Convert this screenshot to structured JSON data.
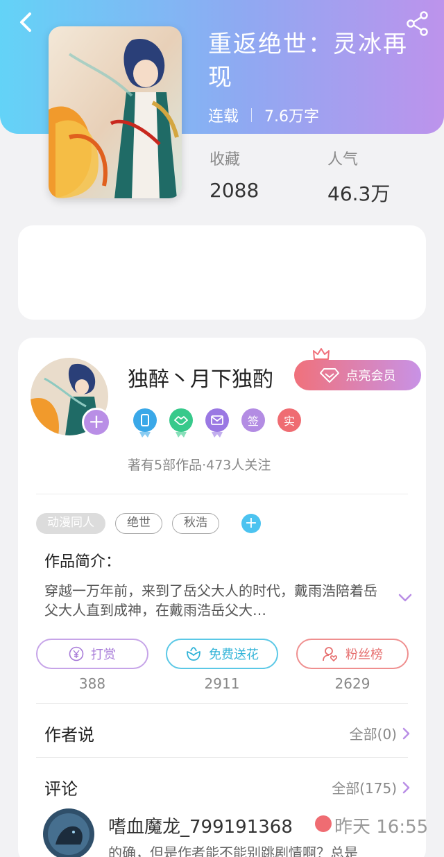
{
  "header": {
    "back_icon": "back-chevron-icon",
    "share_icon": "share-icon",
    "gradient": [
      "#63d3f7",
      "#bd93ec"
    ]
  },
  "book": {
    "title": "重返绝世：灵冰再现",
    "status": "连载",
    "word_count": "7.6万字",
    "stats": [
      {
        "label": "收藏",
        "value": "2088"
      },
      {
        "label": "人气",
        "value": "46.3万"
      }
    ]
  },
  "author": {
    "name": "独醉丶月下独酌",
    "vip_button": "点亮会员",
    "badges": [
      {
        "icon": "phone-badge-icon",
        "text": ""
      },
      {
        "icon": "handshake-badge-icon",
        "text": ""
      },
      {
        "icon": "envelope-badge-icon",
        "text": ""
      },
      {
        "icon": "sign-badge",
        "text": "签"
      },
      {
        "icon": "real-badge",
        "text": "实"
      }
    ],
    "works_info": "著有5部作品·473人关注"
  },
  "tags": {
    "items": [
      "动漫同人",
      "绝世",
      "秋浩"
    ],
    "add_icon": "plus-icon"
  },
  "intro": {
    "title": "作品简介：",
    "text": "穿越一万年前，来到了岳父大人的时代，戴雨浩陪着岳父大人直到成神，在戴雨浩岳父大…"
  },
  "actions": [
    {
      "label": "打赏",
      "icon": "yen-icon",
      "count": "388",
      "color": "#a77ad8"
    },
    {
      "label": "免费送花",
      "icon": "flower-icon",
      "count": "2911",
      "color": "#33b4d8"
    },
    {
      "label": "粉丝榜",
      "icon": "fan-user-icon",
      "count": "2629",
      "color": "#e66f6f"
    }
  ],
  "author_says": {
    "title": "作者说",
    "link": "全部(0)"
  },
  "comments": {
    "title": "评论",
    "link": "全部(175)",
    "first": {
      "user": "嗜血魔龙_799191368",
      "time": "昨天 16:55",
      "text": "的确，但是作者能不能别跳剧情啊？总是"
    }
  }
}
